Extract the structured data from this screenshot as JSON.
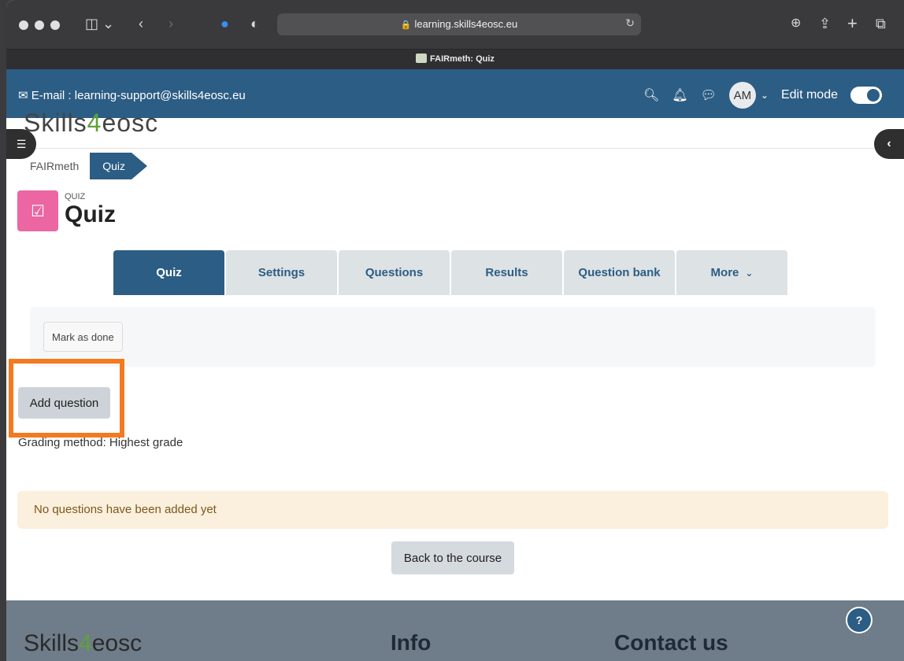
{
  "browser": {
    "url": "learning.skills4eosc.eu",
    "tab_title": "FAIRmeth: Quiz"
  },
  "topnav": {
    "email": "E-mail : learning-support@skills4eosc.eu",
    "avatar_initials": "AM",
    "edit_mode_label": "Edit mode",
    "edit_mode_on": true
  },
  "logo": {
    "prefix": "Skills",
    "four": "4",
    "suffix": "eosc"
  },
  "breadcrumb": {
    "course": "FAIRmeth",
    "current": "Quiz"
  },
  "activity": {
    "kind": "QUIZ",
    "title": "Quiz"
  },
  "tabs": [
    {
      "label": "Quiz",
      "active": true
    },
    {
      "label": "Settings",
      "active": false
    },
    {
      "label": "Questions",
      "active": false
    },
    {
      "label": "Results",
      "active": false
    },
    {
      "label": "Question bank",
      "active": false
    },
    {
      "label": "More",
      "active": false
    }
  ],
  "actions": {
    "mark_done": "Mark as done",
    "add_question": "Add question",
    "back_to_course": "Back to the course"
  },
  "grading_method": "Grading method: Highest grade",
  "notice": "No questions have been added yet",
  "footer": {
    "info_heading": "Info",
    "contact_heading": "Contact us",
    "help_label": "?"
  },
  "colors": {
    "brand": "#2c5d84",
    "highlight": "#f47a20",
    "quiz_icon": "#eb66a2",
    "notice_bg": "#fbefdd"
  }
}
